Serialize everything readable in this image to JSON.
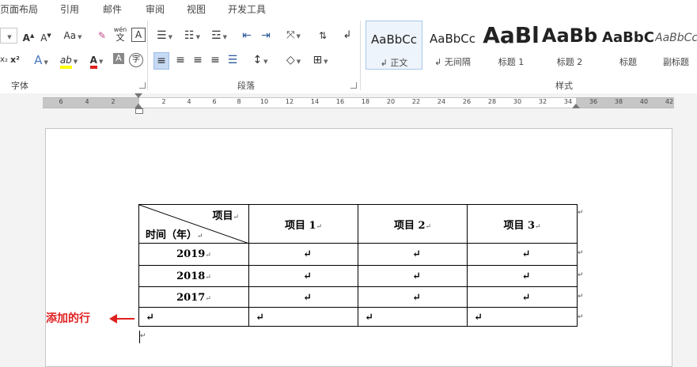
{
  "menu_tabs": [
    "页面布局",
    "引用",
    "邮件",
    "审阅",
    "视图",
    "开发工具"
  ],
  "groups": {
    "font": "字体",
    "paragraph": "段落",
    "styles": "样式"
  },
  "font_tools": {
    "grow": "A",
    "shrink": "A",
    "case": "Aa",
    "pinyin_top": "wén",
    "pinyin_bottom": "文",
    "border_char": "A",
    "superscript": "x²",
    "subscript": "x₂",
    "effects": "A",
    "highlight": "ab",
    "color": "A",
    "shade": "A",
    "enclose": "字"
  },
  "styles": [
    {
      "sample": "AaBbCc",
      "name": "正文",
      "selected": true
    },
    {
      "sample": "AaBbCc",
      "name": "无间隔",
      "selected": false
    },
    {
      "sample": "AaBl",
      "name": "标题 1",
      "selected": false
    },
    {
      "sample": "AaBb",
      "name": "标题 2",
      "selected": false
    },
    {
      "sample": "AaBbC",
      "name": "标题",
      "selected": false
    },
    {
      "sample": "AaBbCc",
      "name": "副标题",
      "selected": false
    }
  ],
  "ruler_labels": [
    "6",
    "4",
    "2",
    "2",
    "4",
    "6",
    "8",
    "10",
    "12",
    "14",
    "16",
    "18",
    "20",
    "22",
    "24",
    "26",
    "28",
    "30",
    "32",
    "34",
    "36",
    "38",
    "40",
    "42"
  ],
  "table": {
    "header_top": "项目",
    "header_bottom": "时间（年）",
    "columns": [
      "项目 1",
      "项目 2",
      "项目 3"
    ],
    "rows": [
      "2019",
      "2018",
      "2017",
      ""
    ]
  },
  "paragraph_mark": "↵",
  "annotation": {
    "text": "添加的行",
    "color": "#e02020"
  },
  "colors": {
    "highlight": "#ffff00",
    "font_color": "#e02020",
    "accent": "#2b579a"
  }
}
